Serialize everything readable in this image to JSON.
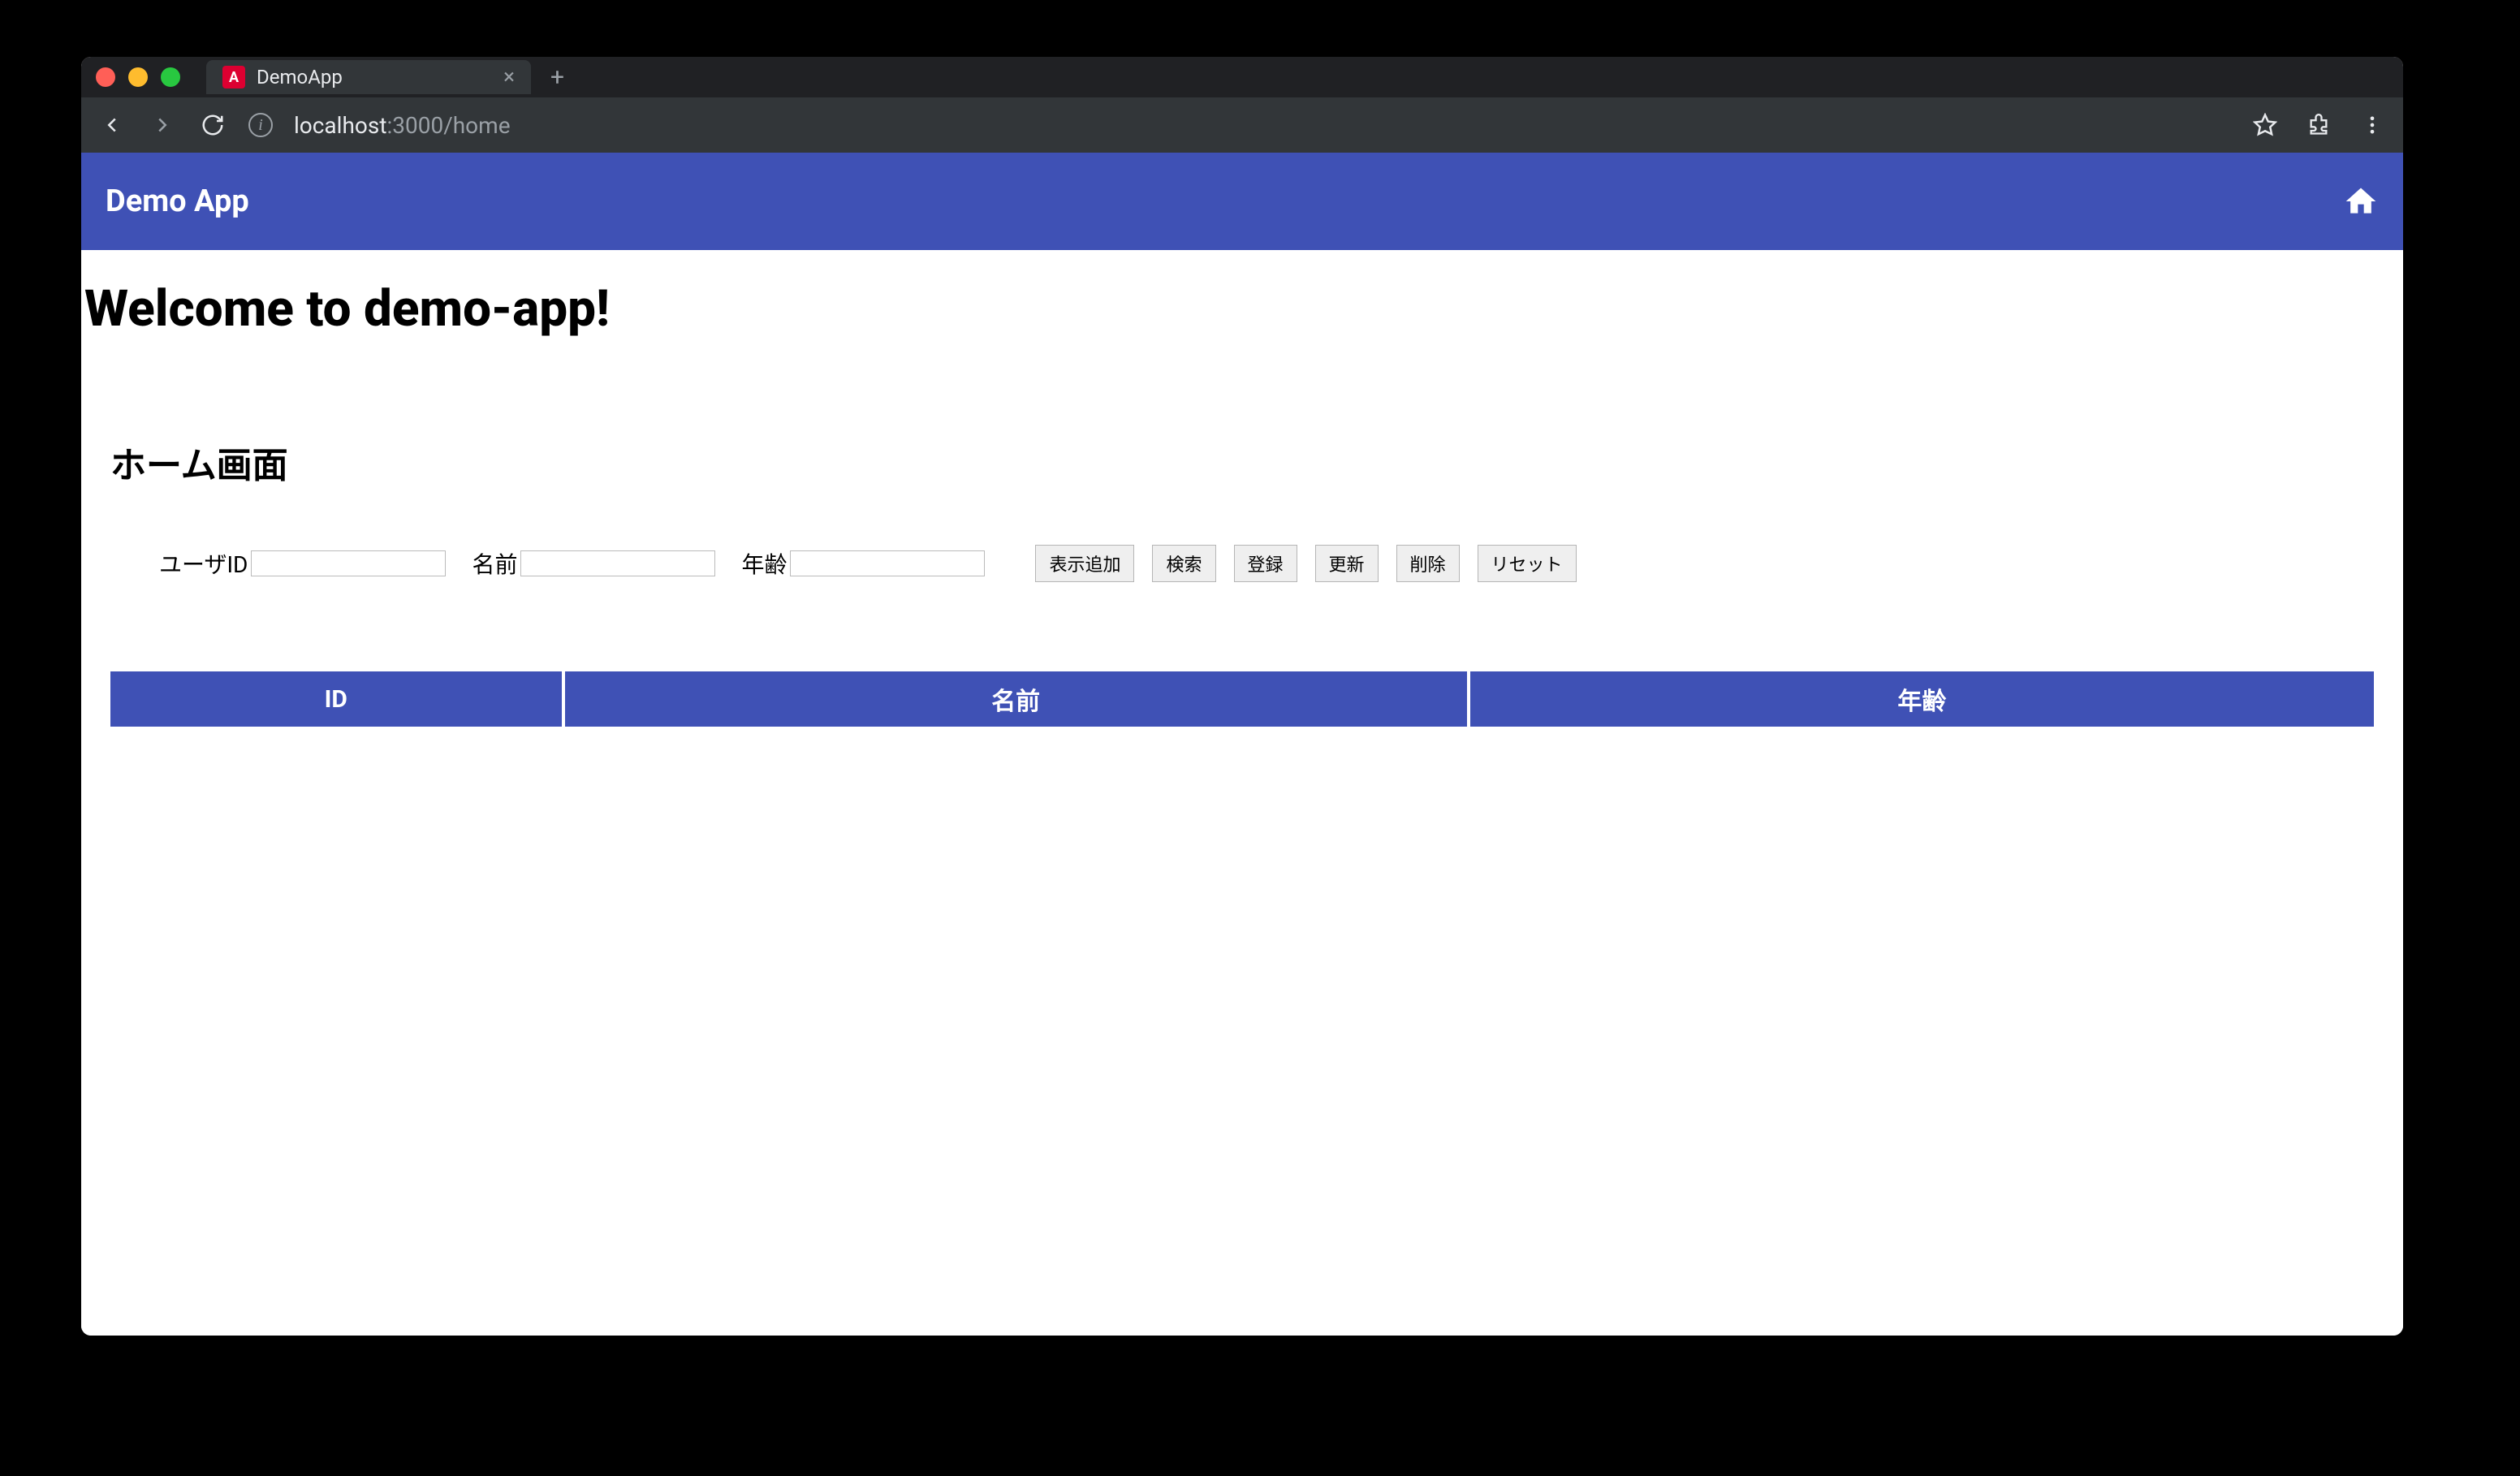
{
  "browser": {
    "tab_title": "DemoApp",
    "url_host": "localhost",
    "url_port_path": ":3000/home"
  },
  "app": {
    "toolbar_title": "Demo App",
    "welcome_heading": "Welcome to demo-app!",
    "section_title": "ホーム画面"
  },
  "form": {
    "user_id_label": "ユーザID",
    "name_label": "名前",
    "age_label": "年齢",
    "user_id_value": "",
    "name_value": "",
    "age_value": ""
  },
  "buttons": {
    "add_display": "表示追加",
    "search": "検索",
    "register": "登録",
    "update": "更新",
    "delete": "削除",
    "reset": "リセット"
  },
  "table": {
    "headers": {
      "id": "ID",
      "name": "名前",
      "age": "年齢"
    },
    "rows": []
  },
  "colors": {
    "primary": "#3f51b5",
    "chrome_dark": "#323639",
    "chrome_darker": "#202124"
  }
}
